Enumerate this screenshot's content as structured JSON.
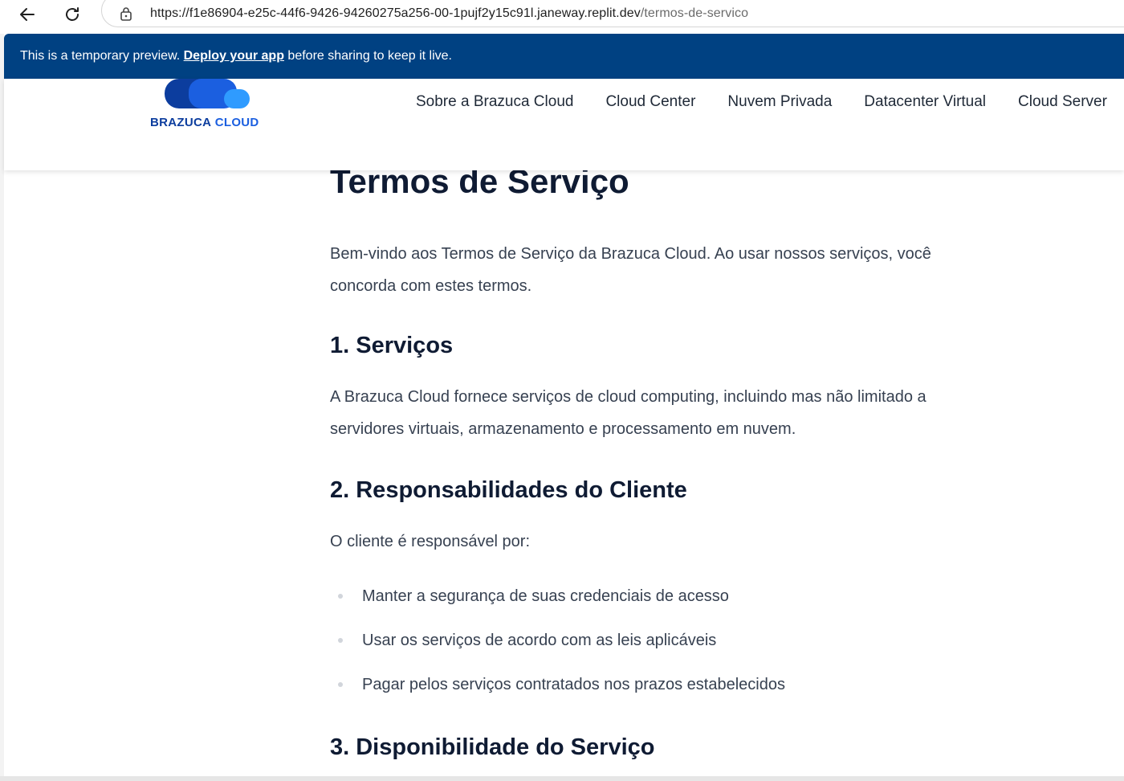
{
  "browser": {
    "url_host": "https://f1e86904-e25c-44f6-9426-94260275a256-00-1pujf2y15c91l.janeway.replit.dev",
    "url_path": "/termos-de-servico"
  },
  "banner": {
    "prefix": "This is a temporary preview. ",
    "link": "Deploy your app",
    "suffix": " before sharing to keep it live."
  },
  "header": {
    "logo_word1": "BRAZUCA",
    "logo_word2": " CLOUD",
    "nav": [
      "Sobre a Brazuca Cloud",
      "Cloud Center",
      "Nuvem Privada",
      "Datacenter Virtual",
      "Cloud Server"
    ]
  },
  "page": {
    "title": "Termos de Serviço",
    "intro": "Bem-vindo aos Termos de Serviço da Brazuca Cloud. Ao usar nossos serviços, você concorda com estes termos.",
    "sections": [
      {
        "heading": "1. Serviços",
        "text": "A Brazuca Cloud fornece serviços de cloud computing, incluindo mas não limitado a servidores virtuais, armazenamento e processamento em nuvem."
      },
      {
        "heading": "2. Responsabilidades do Cliente",
        "text": "O cliente é responsável por:",
        "items": [
          "Manter a segurança de suas credenciais de acesso",
          "Usar os serviços de acordo com as leis aplicáveis",
          "Pagar pelos serviços contratados nos prazos estabelecidos"
        ]
      },
      {
        "heading": "3. Disponibilidade do Serviço"
      }
    ]
  },
  "colors": {
    "banner_bg": "#004182",
    "heading": "#0f1b33",
    "body_text": "#374151",
    "logo_blue": "#1b5fe0",
    "logo_dark": "#0c3d9e"
  }
}
